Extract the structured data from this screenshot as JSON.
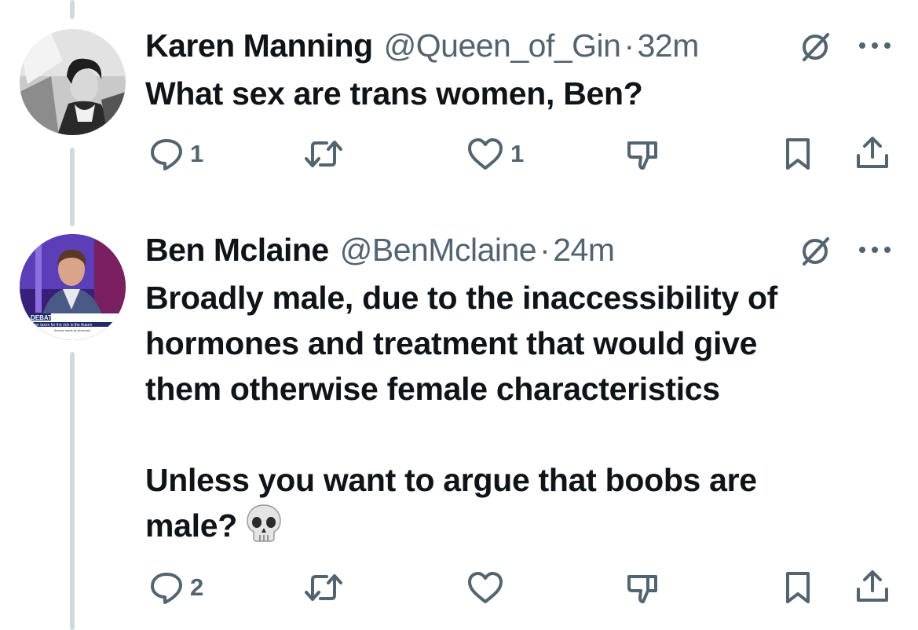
{
  "tweets": [
    {
      "name": "Karen Manning",
      "handle": "@Queen_of_Gin",
      "separator": "·",
      "time": "32m",
      "text": "What sex are trans women, Ben?",
      "replies": "1",
      "likes": "1",
      "avatar_icon": "profile-photo"
    },
    {
      "name": "Ben Mclaine",
      "handle": "@BenMclaine",
      "separator": "·",
      "time": "24m",
      "text": "Broadly male, due to the inaccessibility of\nhormones and treatment that would give\nthem otherwise female characteristics\n\nUnless you want to argue that boobs are\nmale?",
      "emoji": "skull",
      "replies": "2",
      "avatar_icon": "profile-photo",
      "avatar_caption": {
        "banner": "DEBATE",
        "line1": "ease taxes for the rich in the Autum",
        "line2": "Arrests made at demonstr"
      }
    }
  ],
  "icons": [
    "reply-icon",
    "retweet-icon",
    "like-icon",
    "dislike-icon",
    "bookmark-icon",
    "share-icon",
    "grok-icon",
    "more-icon"
  ],
  "colors": {
    "text": "#0f1419",
    "secondary": "#536471",
    "thread_line": "#cfd9de",
    "background": "#ffffff"
  }
}
